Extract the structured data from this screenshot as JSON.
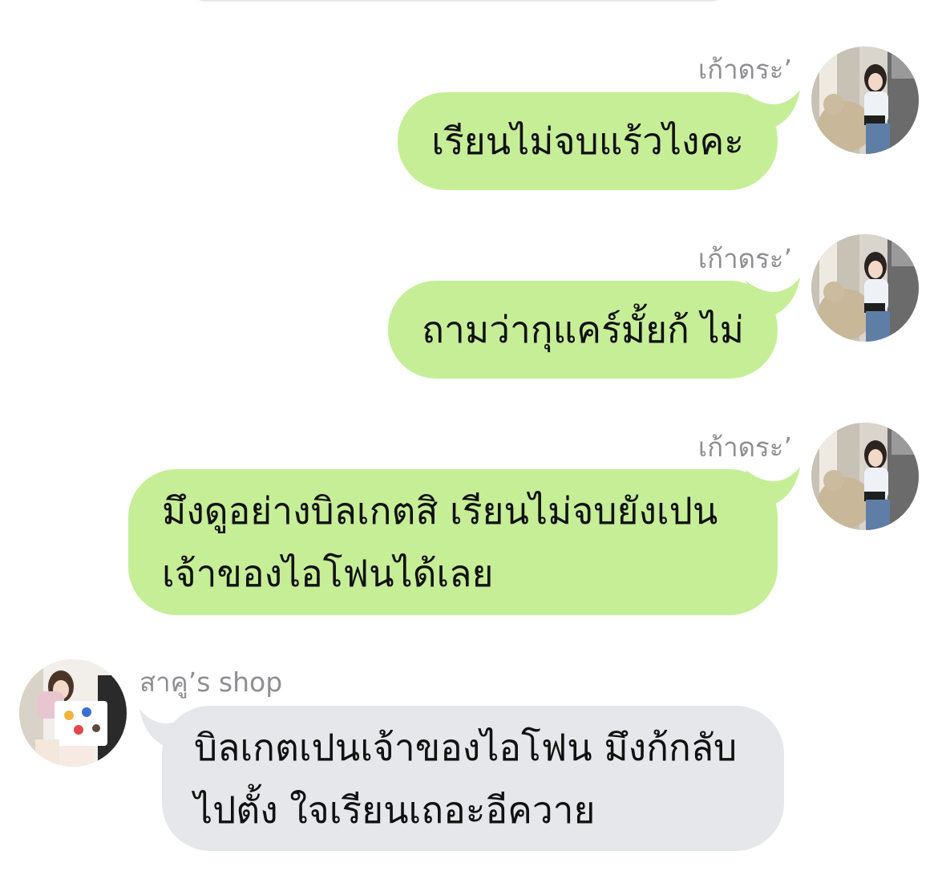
{
  "colors": {
    "outgoing_bubble": "#c6ee97",
    "incoming_bubble": "#e5e7ea",
    "name_text": "#8e8e93",
    "message_text": "#111111",
    "background": "#ffffff"
  },
  "messages": [
    {
      "direction": "outgoing",
      "sender": "เก้าดระ’",
      "avatar_icon": "profile-photo-girl-with-teddy-bear",
      "lines": [
        "เรียนไม่จบแร้วไงคะ"
      ]
    },
    {
      "direction": "outgoing",
      "sender": "เก้าดระ’",
      "avatar_icon": "profile-photo-girl-with-teddy-bear",
      "lines": [
        "ถามว่ากุแคร์มั้ยก้ ไม่"
      ]
    },
    {
      "direction": "outgoing",
      "sender": "เก้าดระ’",
      "avatar_icon": "profile-photo-girl-with-teddy-bear",
      "lines": [
        "มึงดูอย่างบิลเกตสิ เรียนไม่จบยังเปน",
        "เจ้าของไอโฟนได้เลย"
      ]
    },
    {
      "direction": "incoming",
      "sender": "สาคู’s shop",
      "avatar_icon": "profile-photo-girl-with-tote-bag",
      "lines": [
        "บิลเกตเปนเจ้าของไอโฟน มึงก้กลับ",
        "ไปตั้ง ใจเรียนเถอะอีควาย"
      ]
    }
  ]
}
